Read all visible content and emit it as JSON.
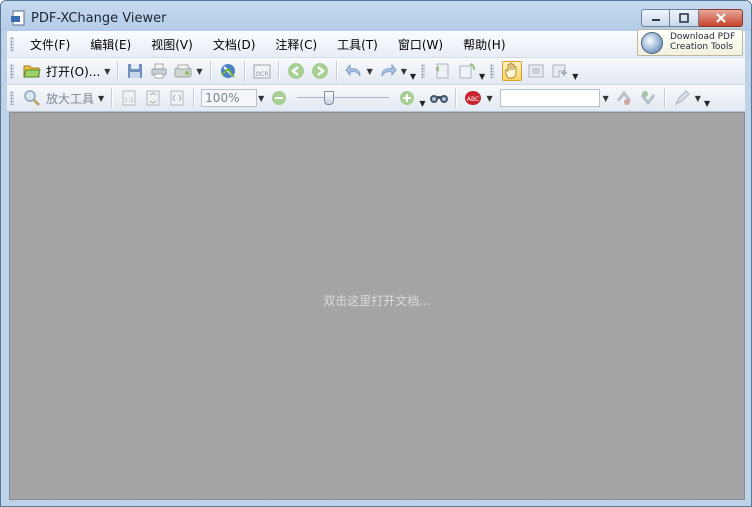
{
  "window": {
    "title": "PDF-XChange Viewer"
  },
  "menu": {
    "items": [
      {
        "name": "file",
        "label": "文件(F)"
      },
      {
        "name": "edit",
        "label": "编辑(E)"
      },
      {
        "name": "view",
        "label": "视图(V)"
      },
      {
        "name": "document",
        "label": "文档(D)"
      },
      {
        "name": "comments",
        "label": "注释(C)"
      },
      {
        "name": "tools",
        "label": "工具(T)"
      },
      {
        "name": "window",
        "label": "窗口(W)"
      },
      {
        "name": "help",
        "label": "帮助(H)"
      }
    ]
  },
  "promo": {
    "line1": "Download PDF",
    "line2": "Creation Tools"
  },
  "toolbar1": {
    "open_label": "打开(O)...",
    "ocr_label": "OCR"
  },
  "toolbar2": {
    "zoom_tool_label": "放大工具",
    "zoom_value": "100%",
    "comment_label": "ABC"
  },
  "content": {
    "hint": "双击这里打开文档..."
  },
  "icons": {
    "app": "pdf-app-icon",
    "open": "folder-open-icon",
    "save": "save-icon",
    "print": "print-icon",
    "scan": "scan-icon",
    "ocr": "ocr-icon",
    "back": "back-arrow-icon",
    "forward": "forward-arrow-icon",
    "undo": "undo-icon",
    "redo": "redo-icon",
    "hand": "hand-tool-icon",
    "zoom_out": "zoom-out-icon",
    "zoom_in": "zoom-in-icon",
    "binoculars": "binoculars-icon",
    "spell": "spell-check-icon"
  },
  "colors": {
    "title_bar": "#bcd3ea",
    "content_bg": "#a3a3a3",
    "close_button": "#c7432c",
    "hand_active": "#ffd56a"
  }
}
